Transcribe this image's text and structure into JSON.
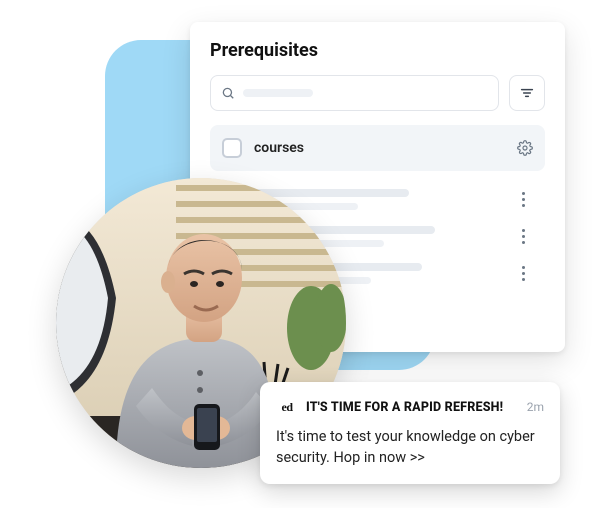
{
  "panel": {
    "title": "Prerequisites",
    "search_placeholder": "",
    "group": {
      "label": "courses"
    },
    "items": [
      {
        "checked": true
      },
      {
        "checked": false
      },
      {
        "checked": false
      }
    ]
  },
  "notification": {
    "app_badge": "ed",
    "title": "IT'S TIME FOR A RAPID REFRESH!",
    "time": "2m",
    "body": "It's time to test your knowledge on cyber security. Hop in now >>"
  },
  "icons": {
    "search": "search-icon",
    "filter": "filter-icon",
    "gear": "gear-icon",
    "kebab": "kebab-icon",
    "check": "check-icon"
  }
}
